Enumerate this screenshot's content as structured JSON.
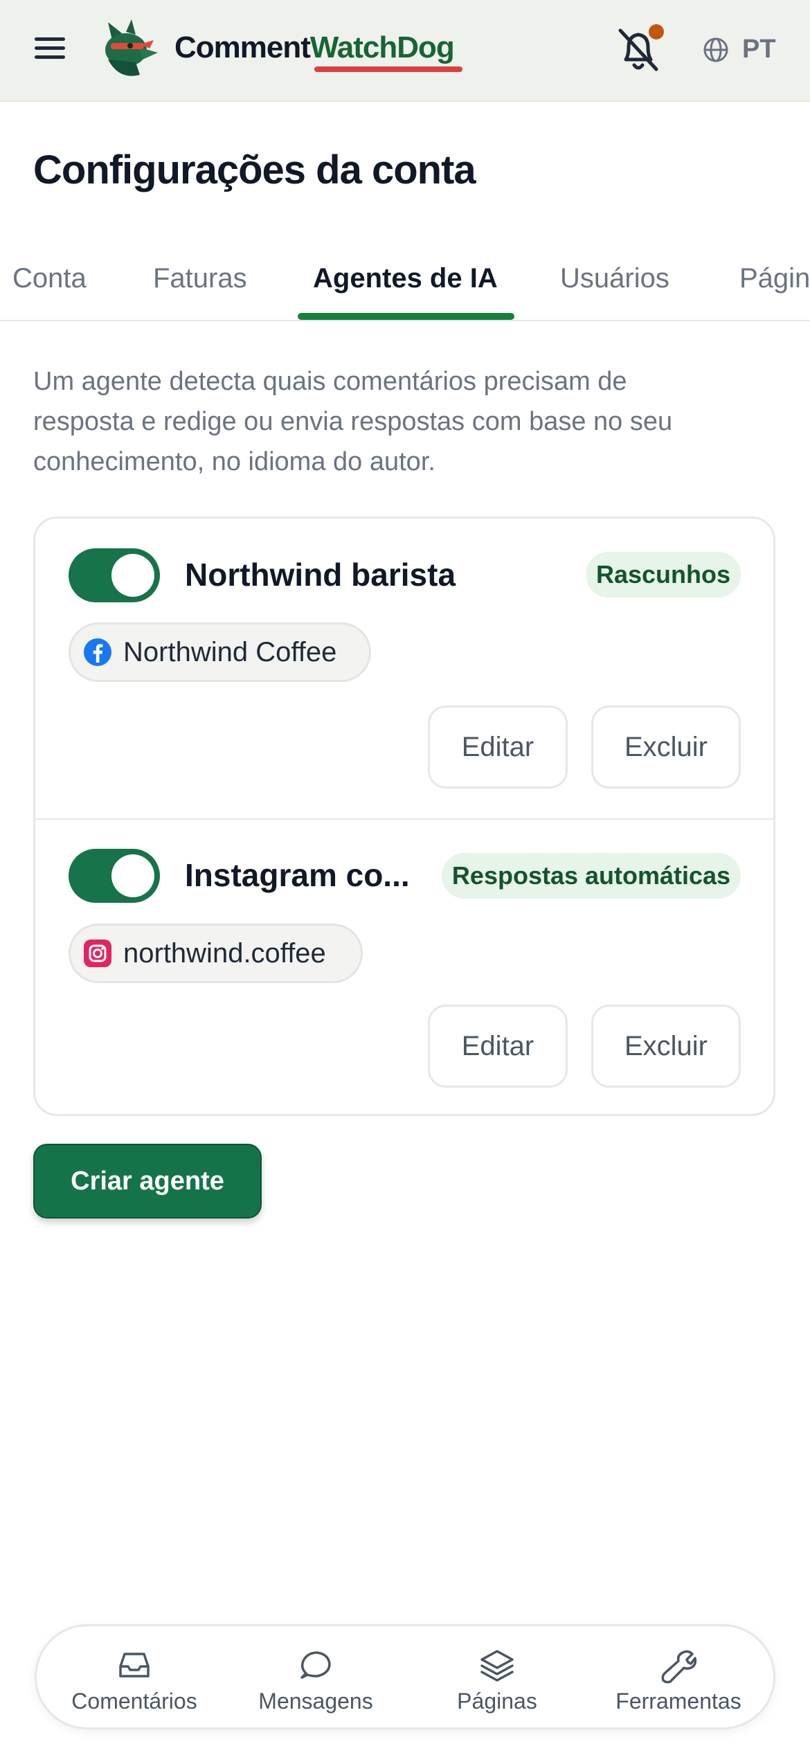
{
  "header": {
    "brand_part1": "Comment",
    "brand_part2": "WatchDog",
    "language": "PT",
    "icons": [
      "menu-icon",
      "dog-logo-icon",
      "bell-off-icon",
      "globe-icon"
    ]
  },
  "page_title": "Configurações da conta",
  "tabs": [
    {
      "label": "Conta"
    },
    {
      "label": "Faturas"
    },
    {
      "label": "Agentes de IA",
      "active": true
    },
    {
      "label": "Usuários"
    },
    {
      "label": "Págin"
    }
  ],
  "description": "Um agente detecta quais comentários precisam de resposta e redige ou envia respostas com base no seu conhecimento, no idioma do autor.",
  "agents": [
    {
      "name": "Northwind barista",
      "enabled": true,
      "mode_badge": "Rascunhos",
      "page": {
        "platform_icon": "facebook-icon",
        "label": "Northwind Coffee"
      },
      "edit_label": "Editar",
      "delete_label": "Excluir"
    },
    {
      "name": "Instagram co...",
      "enabled": true,
      "mode_badge": "Respostas automáticas",
      "page": {
        "platform_icon": "instagram-icon",
        "label": "northwind.coffee"
      },
      "edit_label": "Editar",
      "delete_label": "Excluir"
    }
  ],
  "create_button": "Criar agente",
  "bottom_nav": [
    {
      "label": "Comentários",
      "icon": "inbox-icon"
    },
    {
      "label": "Mensagens",
      "icon": "chat-bubble-icon"
    },
    {
      "label": "Páginas",
      "icon": "layers-icon"
    },
    {
      "label": "Ferramentas",
      "icon": "wrench-icon"
    }
  ],
  "colors": {
    "accent": "#15734a",
    "badge_bg": "#e6f4ea",
    "notification_dot": "#c2570c",
    "brand_underline": "#dc3f3f"
  }
}
